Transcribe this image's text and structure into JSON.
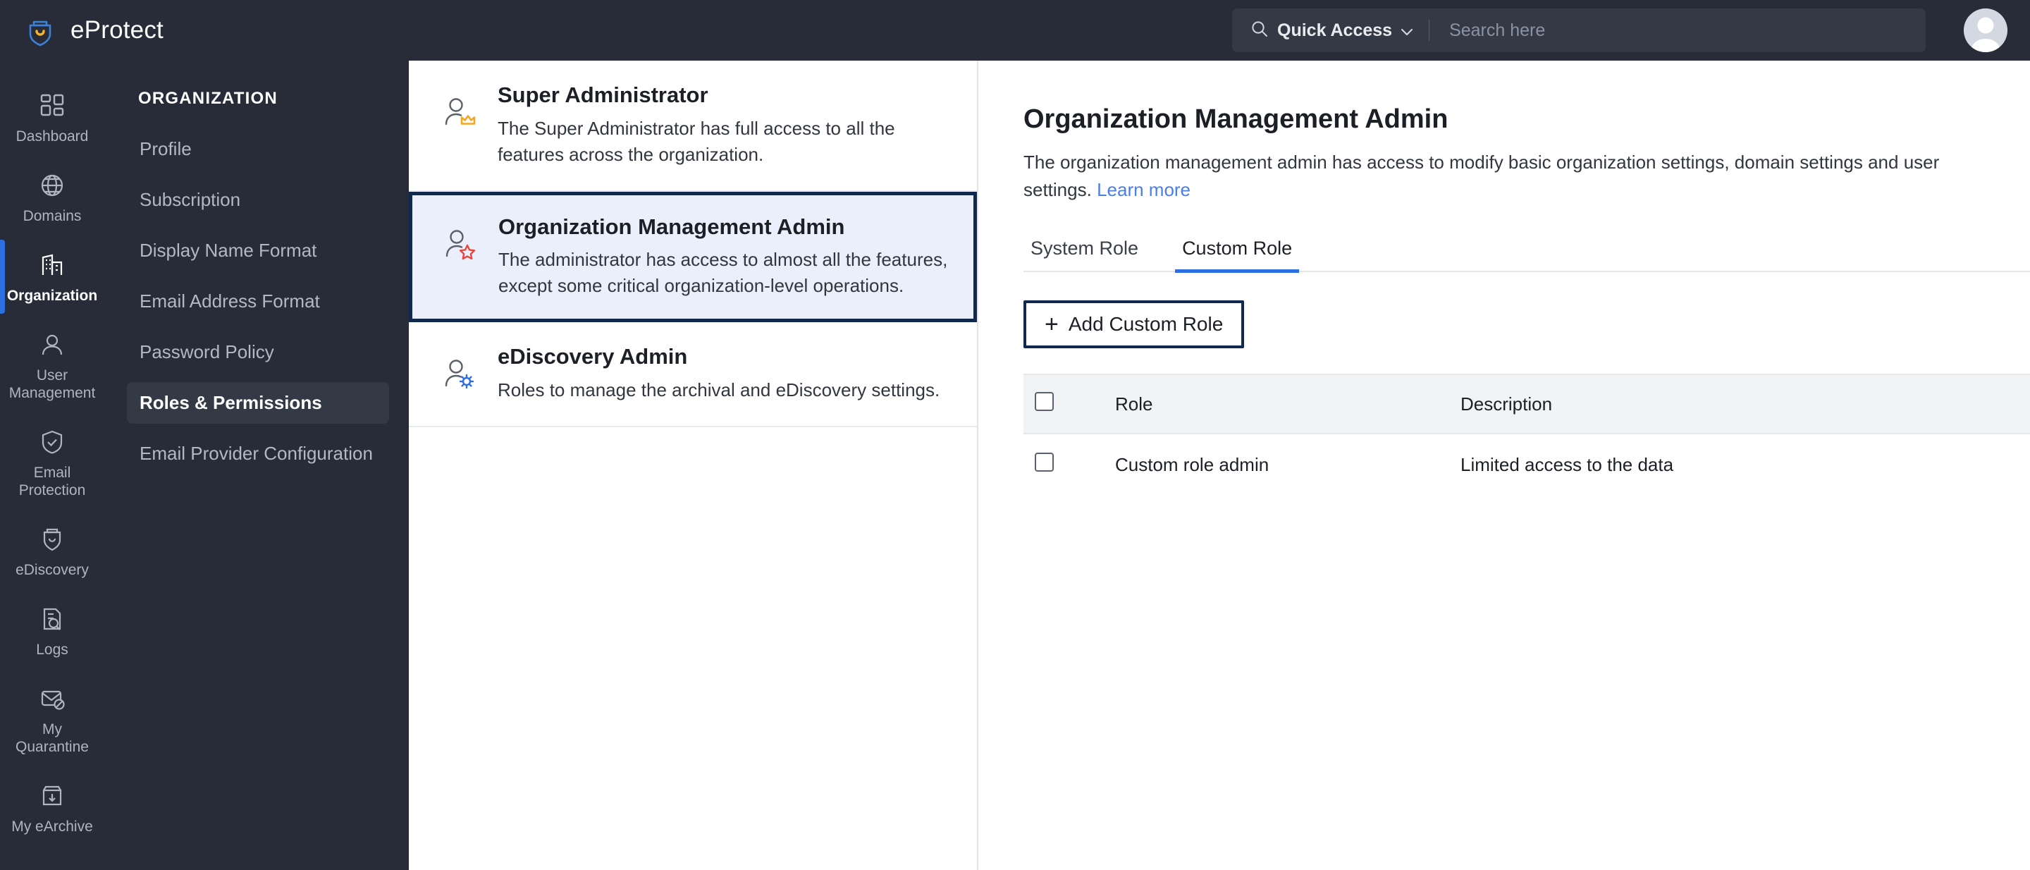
{
  "brand": {
    "name": "eProtect",
    "logo_icon": "shield-logo-icon"
  },
  "topbar": {
    "quick_access_label": "Quick Access",
    "quick_access_icon": "search-icon",
    "chevron_icon": "chevron-down-icon",
    "search_placeholder": "Search here",
    "search_value": "",
    "avatar_icon": "user-avatar-icon"
  },
  "rail": {
    "items": [
      {
        "label": "Dashboard",
        "icon": "dashboard-grid-icon",
        "active": false
      },
      {
        "label": "Domains",
        "icon": "globe-icon",
        "active": false
      },
      {
        "label": "Organization",
        "icon": "building-icon",
        "active": true
      },
      {
        "label": "User Management",
        "icon": "user-icon",
        "active": false
      },
      {
        "label": "Email Protection",
        "icon": "shield-check-icon",
        "active": false
      },
      {
        "label": "eDiscovery",
        "icon": "ediscovery-shield-icon",
        "active": false
      },
      {
        "label": "Logs",
        "icon": "document-search-icon",
        "active": false
      },
      {
        "label": "My Quarantine",
        "icon": "mail-blocked-icon",
        "active": false
      },
      {
        "label": "My eArchive",
        "icon": "archive-download-icon",
        "active": false
      }
    ]
  },
  "subnav": {
    "title": "ORGANIZATION",
    "items": [
      {
        "label": "Profile",
        "active": false
      },
      {
        "label": "Subscription",
        "active": false
      },
      {
        "label": "Display Name Format",
        "active": false
      },
      {
        "label": "Email Address Format",
        "active": false
      },
      {
        "label": "Password Policy",
        "active": false
      },
      {
        "label": "Roles & Permissions",
        "active": true
      },
      {
        "label": "Email Provider Configuration",
        "active": false
      }
    ]
  },
  "role_list": [
    {
      "title": "Super Administrator",
      "description": "The Super Administrator has full access to all the features across the organization.",
      "icon": "user-crown-icon",
      "selected": false
    },
    {
      "title": "Organization Management Admin",
      "description": "The administrator has access to almost all the features, except some critical organization-level operations.",
      "icon": "user-star-icon",
      "selected": true
    },
    {
      "title": "eDiscovery Admin",
      "description": "Roles to manage the archival and eDiscovery settings.",
      "icon": "user-gear-icon",
      "selected": false
    }
  ],
  "detail": {
    "title": "Organization Management Admin",
    "description": "The organization management admin has access to modify basic organization settings, domain settings and user settings.",
    "learn_more_label": "Learn more",
    "tabs": [
      {
        "label": "System Role",
        "active": false
      },
      {
        "label": "Custom Role",
        "active": true
      }
    ],
    "add_button_label": "Add Custom Role",
    "add_button_icon": "plus-icon",
    "table": {
      "columns": [
        "Role",
        "Description"
      ],
      "rows": [
        {
          "role": "Custom role admin",
          "description": "Limited access to the data",
          "checked": false
        }
      ]
    }
  },
  "colors": {
    "sidebar_bg": "#272c38",
    "accent_blue": "#2d6fe0",
    "selected_card_border": "#12294e",
    "selected_card_bg": "#eaeffb",
    "link_blue": "#4a7ee8",
    "crown_orange": "#f5a623",
    "star_red": "#e8453c",
    "gear_blue": "#2d6fe0"
  }
}
